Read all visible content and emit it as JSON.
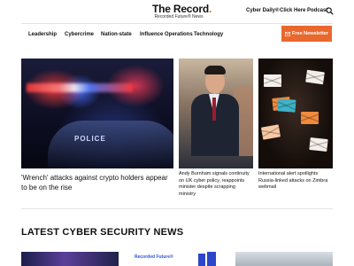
{
  "header": {
    "logo_title": "The Record",
    "logo_dot": ".",
    "logo_subtitle": "Recorded Future® News",
    "links": [
      "Cyber Daily®",
      "Click Here Podcast"
    ]
  },
  "nav": {
    "items": [
      "Leadership",
      "Cybercrime",
      "Nation-state",
      "Influence Operations",
      "Technology"
    ],
    "newsletter_label": "Free Newsletter"
  },
  "featured": {
    "main_headline": "'Wrench' attacks against crypto holders appear to be on the rise",
    "main_image_text": "POLICE",
    "story2_headline": "Andy Burnham signals continuity on UK cyber policy, reappoints minister despite scrapping ministry",
    "story3_headline": "International alert spotlights Russia-linked attacks on Zimbra webmail"
  },
  "latest": {
    "title": "LATEST CYBER SECURITY NEWS",
    "thumb2_text": "Recorded Future®"
  },
  "colors": {
    "accent": "#e8682e",
    "text": "#111111",
    "divider": "#e3e3e3"
  },
  "icons": {
    "search": "search-icon",
    "newsletter": "mail-icon"
  }
}
